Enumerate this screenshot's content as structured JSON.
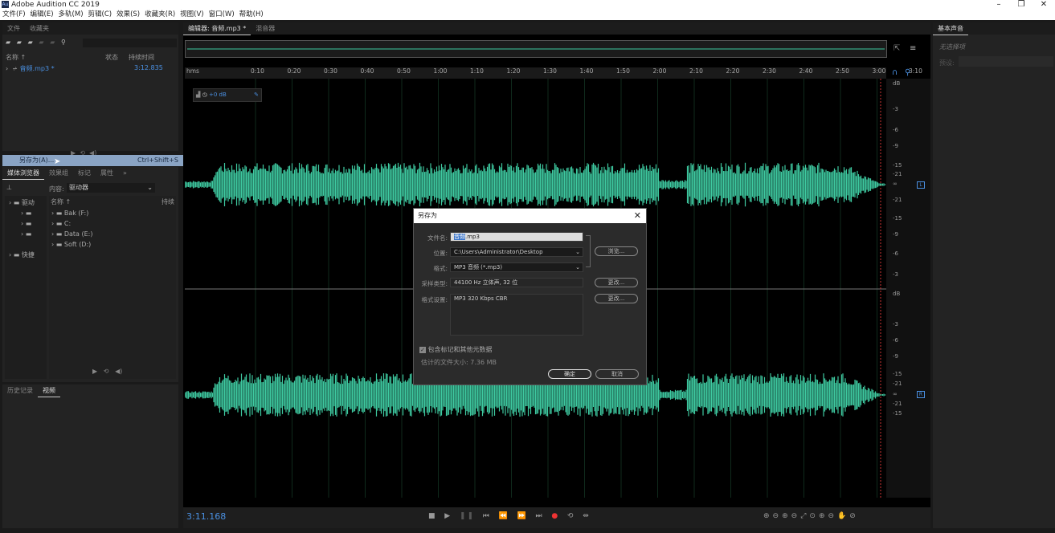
{
  "window": {
    "title": "Adobe Audition CC 2019",
    "logo": "Au"
  },
  "menu": [
    "文件(F)",
    "编辑(E)",
    "多轨(M)",
    "剪辑(C)",
    "效果(S)",
    "收藏夹(R)",
    "视图(V)",
    "窗口(W)",
    "帮助(H)"
  ],
  "files_panel": {
    "tabs": [
      "文件",
      "收藏夹"
    ],
    "col_name": "名称 ↑",
    "col_status": "状态",
    "col_duration": "持续时间",
    "file_name": "音频.mp3 *",
    "file_duration": "3:12.835"
  },
  "context_menu": {
    "label": "另存为(A)...",
    "shortcut": "Ctrl+Shift+S"
  },
  "media_panel": {
    "tabs": [
      "媒体浏览器",
      "效果组",
      "标记",
      "属性"
    ],
    "content_label": "内容:",
    "content_value": "驱动器",
    "tree": [
      "驱动",
      "",
      "",
      "",
      "快捷"
    ],
    "col_name": "名称 ↑",
    "col_duration": "持续",
    "drives": [
      "Bak (F:)",
      "C:",
      "Data (E:)",
      "Soft (D:)"
    ]
  },
  "bottom_left_tabs": [
    "历史记录",
    "视频"
  ],
  "editor": {
    "tabs": [
      "编辑器: 音频.mp3 *",
      "混音器"
    ],
    "ruler_unit": "hms",
    "ruler_ticks": [
      "0:10",
      "0:20",
      "0:30",
      "0:40",
      "0:50",
      "1:00",
      "1:10",
      "1:20",
      "1:30",
      "1:40",
      "1:50",
      "2:00",
      "2:10",
      "2:20",
      "2:30",
      "2:40",
      "2:50",
      "3:00",
      "3:10"
    ],
    "gain": "+0 dB",
    "db_top": [
      "dB",
      "-3",
      "-6",
      "-9",
      "-15",
      "-21",
      "∞",
      "-21",
      "-15",
      "-9",
      "-6",
      "-3"
    ],
    "db_bottom": [
      "dB",
      "-3",
      "-6",
      "-9",
      "-15",
      "-21",
      "∞",
      "-21",
      "-15"
    ],
    "channel_left": "L",
    "channel_right": "R",
    "time": "3:11.168",
    "wave_color": "#3ec9a0"
  },
  "dialog": {
    "title": "另存为",
    "filename_label": "文件名:",
    "filename_sel": "音频",
    "filename_rest": ".mp3",
    "location_label": "位置:",
    "location_value": "C:\\Users\\Administrator\\Desktop",
    "browse": "浏览...",
    "format_label": "格式:",
    "format_value": "MP3 音频 (*.mp3)",
    "sample_label": "采样类型:",
    "sample_value": "44100 Hz 立体声, 32 位",
    "change1": "更改...",
    "fmtset_label": "格式设置:",
    "fmtset_value": "MP3 320 Kbps CBR",
    "change2": "更改...",
    "include_meta": "包含标记和其他元数据",
    "estimate": "估计的文件大小: 7.36 MB",
    "ok": "确定",
    "cancel": "取消"
  },
  "right_panel": {
    "title": "基本声音",
    "no_selection": "无选择项",
    "preset_label": "预设:"
  }
}
